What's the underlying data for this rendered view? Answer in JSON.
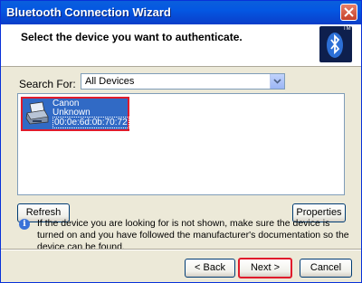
{
  "window": {
    "title": "Bluetooth Connection Wizard",
    "close_icon": "close-icon"
  },
  "header": {
    "title": "Select the device you want to authenticate.",
    "logo_icon": "bluetooth-logo-icon",
    "logo_mark": "TM"
  },
  "search": {
    "label": "Search For:",
    "selected": "All Devices"
  },
  "devices": [
    {
      "name": "Canon",
      "status": "Unknown",
      "address": "00:0e:6d:0b:70:72",
      "icon": "printer-icon",
      "selected": true
    }
  ],
  "buttons": {
    "refresh": "Refresh",
    "properties": "Properties",
    "back_arrow": "<",
    "back": "Back",
    "next": "Next",
    "next_arrow": ">",
    "cancel": "Cancel"
  },
  "info": {
    "icon": "info-icon",
    "text": "If the device you are looking for is not shown, make sure the device is turned on and you have followed the manufacturer's documentation so the device can be found."
  },
  "colors": {
    "titlebar": "#0a5fdc",
    "selection": "#316ac5",
    "highlight": "#e01b2b"
  }
}
